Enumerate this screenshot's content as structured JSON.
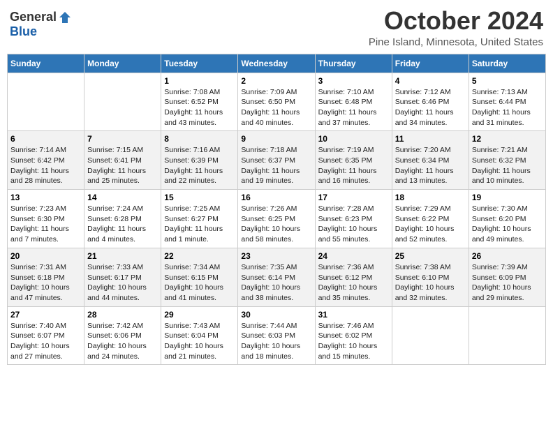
{
  "header": {
    "logo_general": "General",
    "logo_blue": "Blue",
    "month_title": "October 2024",
    "location": "Pine Island, Minnesota, United States"
  },
  "weekdays": [
    "Sunday",
    "Monday",
    "Tuesday",
    "Wednesday",
    "Thursday",
    "Friday",
    "Saturday"
  ],
  "weeks": [
    [
      {
        "day": "",
        "info": ""
      },
      {
        "day": "",
        "info": ""
      },
      {
        "day": "1",
        "info": "Sunrise: 7:08 AM\nSunset: 6:52 PM\nDaylight: 11 hours and 43 minutes."
      },
      {
        "day": "2",
        "info": "Sunrise: 7:09 AM\nSunset: 6:50 PM\nDaylight: 11 hours and 40 minutes."
      },
      {
        "day": "3",
        "info": "Sunrise: 7:10 AM\nSunset: 6:48 PM\nDaylight: 11 hours and 37 minutes."
      },
      {
        "day": "4",
        "info": "Sunrise: 7:12 AM\nSunset: 6:46 PM\nDaylight: 11 hours and 34 minutes."
      },
      {
        "day": "5",
        "info": "Sunrise: 7:13 AM\nSunset: 6:44 PM\nDaylight: 11 hours and 31 minutes."
      }
    ],
    [
      {
        "day": "6",
        "info": "Sunrise: 7:14 AM\nSunset: 6:42 PM\nDaylight: 11 hours and 28 minutes."
      },
      {
        "day": "7",
        "info": "Sunrise: 7:15 AM\nSunset: 6:41 PM\nDaylight: 11 hours and 25 minutes."
      },
      {
        "day": "8",
        "info": "Sunrise: 7:16 AM\nSunset: 6:39 PM\nDaylight: 11 hours and 22 minutes."
      },
      {
        "day": "9",
        "info": "Sunrise: 7:18 AM\nSunset: 6:37 PM\nDaylight: 11 hours and 19 minutes."
      },
      {
        "day": "10",
        "info": "Sunrise: 7:19 AM\nSunset: 6:35 PM\nDaylight: 11 hours and 16 minutes."
      },
      {
        "day": "11",
        "info": "Sunrise: 7:20 AM\nSunset: 6:34 PM\nDaylight: 11 hours and 13 minutes."
      },
      {
        "day": "12",
        "info": "Sunrise: 7:21 AM\nSunset: 6:32 PM\nDaylight: 11 hours and 10 minutes."
      }
    ],
    [
      {
        "day": "13",
        "info": "Sunrise: 7:23 AM\nSunset: 6:30 PM\nDaylight: 11 hours and 7 minutes."
      },
      {
        "day": "14",
        "info": "Sunrise: 7:24 AM\nSunset: 6:28 PM\nDaylight: 11 hours and 4 minutes."
      },
      {
        "day": "15",
        "info": "Sunrise: 7:25 AM\nSunset: 6:27 PM\nDaylight: 11 hours and 1 minute."
      },
      {
        "day": "16",
        "info": "Sunrise: 7:26 AM\nSunset: 6:25 PM\nDaylight: 10 hours and 58 minutes."
      },
      {
        "day": "17",
        "info": "Sunrise: 7:28 AM\nSunset: 6:23 PM\nDaylight: 10 hours and 55 minutes."
      },
      {
        "day": "18",
        "info": "Sunrise: 7:29 AM\nSunset: 6:22 PM\nDaylight: 10 hours and 52 minutes."
      },
      {
        "day": "19",
        "info": "Sunrise: 7:30 AM\nSunset: 6:20 PM\nDaylight: 10 hours and 49 minutes."
      }
    ],
    [
      {
        "day": "20",
        "info": "Sunrise: 7:31 AM\nSunset: 6:18 PM\nDaylight: 10 hours and 47 minutes."
      },
      {
        "day": "21",
        "info": "Sunrise: 7:33 AM\nSunset: 6:17 PM\nDaylight: 10 hours and 44 minutes."
      },
      {
        "day": "22",
        "info": "Sunrise: 7:34 AM\nSunset: 6:15 PM\nDaylight: 10 hours and 41 minutes."
      },
      {
        "day": "23",
        "info": "Sunrise: 7:35 AM\nSunset: 6:14 PM\nDaylight: 10 hours and 38 minutes."
      },
      {
        "day": "24",
        "info": "Sunrise: 7:36 AM\nSunset: 6:12 PM\nDaylight: 10 hours and 35 minutes."
      },
      {
        "day": "25",
        "info": "Sunrise: 7:38 AM\nSunset: 6:10 PM\nDaylight: 10 hours and 32 minutes."
      },
      {
        "day": "26",
        "info": "Sunrise: 7:39 AM\nSunset: 6:09 PM\nDaylight: 10 hours and 29 minutes."
      }
    ],
    [
      {
        "day": "27",
        "info": "Sunrise: 7:40 AM\nSunset: 6:07 PM\nDaylight: 10 hours and 27 minutes."
      },
      {
        "day": "28",
        "info": "Sunrise: 7:42 AM\nSunset: 6:06 PM\nDaylight: 10 hours and 24 minutes."
      },
      {
        "day": "29",
        "info": "Sunrise: 7:43 AM\nSunset: 6:04 PM\nDaylight: 10 hours and 21 minutes."
      },
      {
        "day": "30",
        "info": "Sunrise: 7:44 AM\nSunset: 6:03 PM\nDaylight: 10 hours and 18 minutes."
      },
      {
        "day": "31",
        "info": "Sunrise: 7:46 AM\nSunset: 6:02 PM\nDaylight: 10 hours and 15 minutes."
      },
      {
        "day": "",
        "info": ""
      },
      {
        "day": "",
        "info": ""
      }
    ]
  ]
}
